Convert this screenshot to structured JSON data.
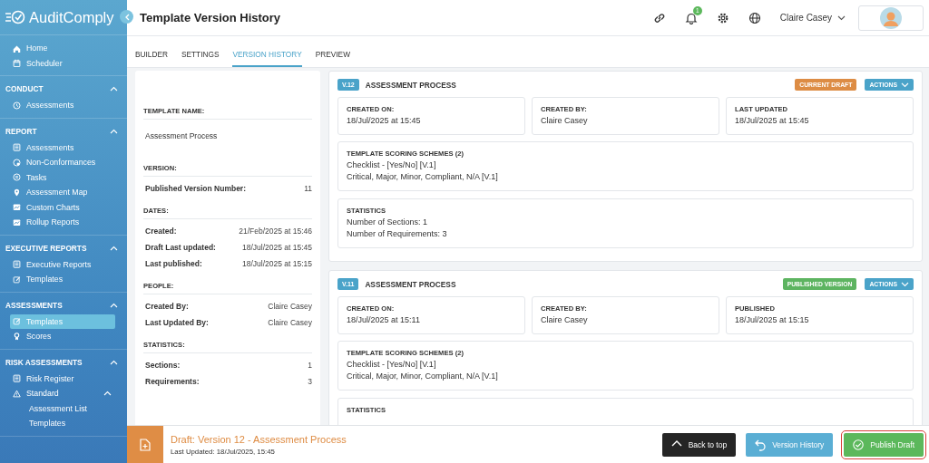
{
  "sidebar": {
    "logo": "AuditComply",
    "top_items": [
      {
        "label": "Home",
        "selected": false
      },
      {
        "label": "Scheduler",
        "selected": false
      }
    ],
    "sections": [
      {
        "title": "CONDUCT",
        "expanded": true,
        "items": [
          {
            "label": "Assessments",
            "selected": false
          }
        ]
      },
      {
        "title": "REPORT",
        "expanded": true,
        "items": [
          {
            "label": "Assessments",
            "selected": false
          },
          {
            "label": "Non-Conformances",
            "selected": false
          },
          {
            "label": "Tasks",
            "selected": false
          },
          {
            "label": "Assessment Map",
            "selected": false
          },
          {
            "label": "Custom Charts",
            "selected": false
          },
          {
            "label": "Rollup Reports",
            "selected": false
          }
        ]
      },
      {
        "title": "EXECUTIVE REPORTS",
        "expanded": true,
        "items": [
          {
            "label": "Executive Reports",
            "selected": false
          },
          {
            "label": "Templates",
            "selected": false
          }
        ]
      },
      {
        "title": "ASSESSMENTS",
        "expanded": true,
        "items": [
          {
            "label": "Templates",
            "selected": true
          },
          {
            "label": "Scores",
            "selected": false
          }
        ]
      },
      {
        "title": "RISK ASSESSMENTS",
        "expanded": true,
        "items": [
          {
            "label": "Risk Register",
            "selected": false
          },
          {
            "label": "Standard",
            "selected": false,
            "expanded": true,
            "children": [
              {
                "label": "Assessment List",
                "selected": false
              },
              {
                "label": "Templates",
                "selected": false
              }
            ]
          }
        ]
      }
    ]
  },
  "header": {
    "title": "Template Version History",
    "notification_count": "1",
    "user_name": "Claire Casey"
  },
  "tabs": [
    {
      "label": "BUILDER",
      "selected": false
    },
    {
      "label": "SETTINGS",
      "selected": false
    },
    {
      "label": "VERSION HISTORY",
      "selected": true
    },
    {
      "label": "PREVIEW",
      "selected": false
    }
  ],
  "summary": [
    {
      "heading": "TEMPLATE NAME:",
      "text": "Assessment Process"
    },
    {
      "heading": "VERSION:",
      "rows": [
        {
          "label": "Published Version Number:",
          "value": "11"
        }
      ]
    },
    {
      "heading": "DATES:",
      "rows": [
        {
          "label": "Created:",
          "value": "21/Feb/2025 at 15:46"
        },
        {
          "label": "Draft Last updated:",
          "value": "18/Jul/2025 at 15:45"
        },
        {
          "label": "Last published:",
          "value": "18/Jul/2025 at 15:15"
        }
      ]
    },
    {
      "heading": "PEOPLE:",
      "rows": [
        {
          "label": "Created By:",
          "value": "Claire Casey"
        },
        {
          "label": "Last Updated By:",
          "value": "Claire Casey"
        }
      ]
    },
    {
      "heading": "STATISTICS:",
      "rows": [
        {
          "label": "Sections:",
          "value": "1"
        },
        {
          "label": "Requirements:",
          "value": "3"
        }
      ]
    }
  ],
  "versions": [
    {
      "version": "V.12",
      "title": "ASSESSMENT PROCESS",
      "status": "CURRENT DRAFT",
      "kind": "draft",
      "actions": "ACTIONS",
      "fields": [
        {
          "label": "CREATED ON:",
          "value": "18/Jul/2025 at 15:45"
        },
        {
          "label": "CREATED BY:",
          "value": "Claire Casey"
        },
        {
          "label": "LAST UPDATED",
          "value": "18/Jul/2025 at 15:45"
        }
      ],
      "blocks": [
        {
          "heading": "TEMPLATE SCORING SCHEMES (2)",
          "lines": [
            "Checklist - [Yes/No] [V.1]",
            "Critical, Major, Minor, Compliant, N/A [V.1]"
          ]
        },
        {
          "heading": "STATISTICS",
          "lines": [
            "Number of Sections: 1",
            "Number of Requirements: 3"
          ]
        }
      ]
    },
    {
      "version": "V.11",
      "title": "ASSESSMENT PROCESS",
      "status": "PUBLISHED VERSION",
      "kind": "published",
      "actions": "ACTIONS",
      "fields": [
        {
          "label": "CREATED ON:",
          "value": "18/Jul/2025 at 15:11"
        },
        {
          "label": "CREATED BY:",
          "value": "Claire Casey"
        },
        {
          "label": "PUBLISHED",
          "value": "18/Jul/2025 at 15:15"
        }
      ],
      "blocks": [
        {
          "heading": "TEMPLATE SCORING SCHEMES (2)",
          "lines": [
            "Checklist - [Yes/No] [V.1]",
            "Critical, Major, Minor, Compliant, N/A [V.1]"
          ]
        },
        {
          "heading": "STATISTICS"
        }
      ]
    }
  ],
  "footer": {
    "title": "Draft: Version 12 - Assessment Process",
    "subtitle": "Last Updated: 18/Jul/2025, 15:45",
    "buttons": [
      {
        "label": "Back to top",
        "kind": "dark",
        "highlighted": false
      },
      {
        "label": "Version History",
        "kind": "info",
        "highlighted": false
      },
      {
        "label": "Publish Draft",
        "kind": "success",
        "highlighted": true
      }
    ]
  }
}
